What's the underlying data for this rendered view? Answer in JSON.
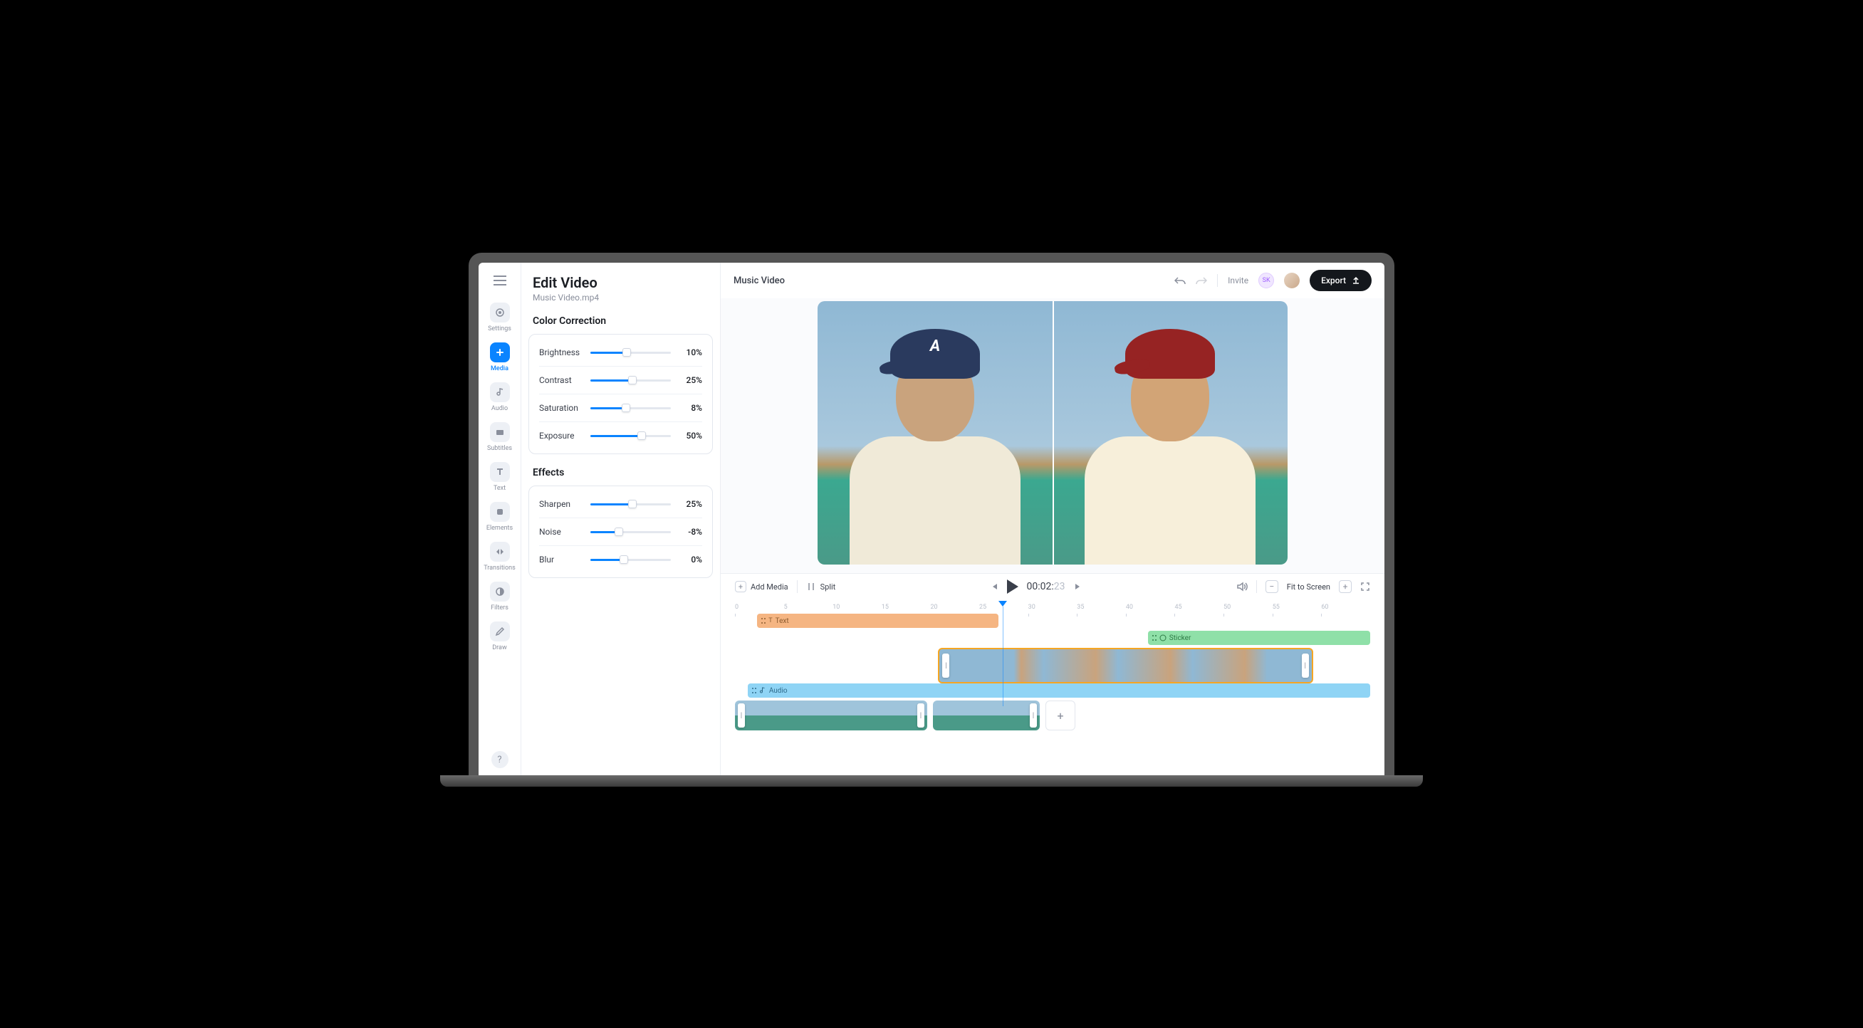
{
  "header": {
    "title": "Edit Video",
    "filename": "Music Video.mp4",
    "project_name": "Music Video",
    "invite_label": "Invite",
    "avatar_initials": "SK",
    "export_label": "Export"
  },
  "sidebar": {
    "items": [
      {
        "label": "Settings"
      },
      {
        "label": "Media"
      },
      {
        "label": "Audio"
      },
      {
        "label": "Subtitles"
      },
      {
        "label": "Text"
      },
      {
        "label": "Elements"
      },
      {
        "label": "Transitions"
      },
      {
        "label": "Filters"
      },
      {
        "label": "Draw"
      }
    ]
  },
  "color_correction": {
    "title": "Color Correction",
    "sliders": [
      {
        "label": "Brightness",
        "value": "10%",
        "fill": 45
      },
      {
        "label": "Contrast",
        "value": "25%",
        "fill": 52
      },
      {
        "label": "Saturation",
        "value": "8%",
        "fill": 44
      },
      {
        "label": "Exposure",
        "value": "50%",
        "fill": 64
      }
    ]
  },
  "effects": {
    "title": "Effects",
    "sliders": [
      {
        "label": "Sharpen",
        "value": "25%",
        "fill": 52
      },
      {
        "label": "Noise",
        "value": "-8%",
        "fill": 35
      },
      {
        "label": "Blur",
        "value": "0%",
        "fill": 42
      }
    ]
  },
  "playbar": {
    "add_media": "Add Media",
    "split": "Split",
    "timecode": "00:02:",
    "timecode_frames": "23",
    "fit_label": "Fit to Screen"
  },
  "timeline": {
    "ticks": [
      "0",
      "5",
      "10",
      "15",
      "20",
      "25",
      "30",
      "35",
      "40",
      "45",
      "50",
      "55",
      "60"
    ],
    "tracks": {
      "text": "Text",
      "sticker": "Sticker",
      "audio": "Audio"
    }
  }
}
